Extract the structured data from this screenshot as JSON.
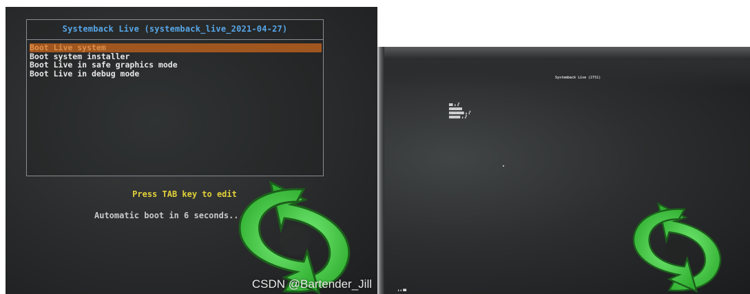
{
  "left_screen": {
    "menu_title": "Systemback Live (systemback_live_2021-04-27)",
    "menu_items": [
      {
        "label": "Boot Live system",
        "selected": true
      },
      {
        "label": "Boot system installer",
        "selected": false
      },
      {
        "label": "Boot Live in safe graphics mode",
        "selected": false
      },
      {
        "label": "Boot Live in debug mode",
        "selected": false
      }
    ],
    "hint": "Press TAB key to edit",
    "countdown": "Automatic boot in 6 seconds...",
    "watermark": "CSDN @Bartender_Jill",
    "logo_icon": "systemback-refresh-arrows-icon"
  },
  "right_screen": {
    "menu_title": "Systemback Live (2751)",
    "logo_icon": "systemback-refresh-arrows-icon"
  },
  "colors": {
    "title_blue": "#58a6e8",
    "selected_bg": "#a0561f",
    "hint_yellow": "#e2d23a",
    "logo_green": "#3cc93c"
  }
}
